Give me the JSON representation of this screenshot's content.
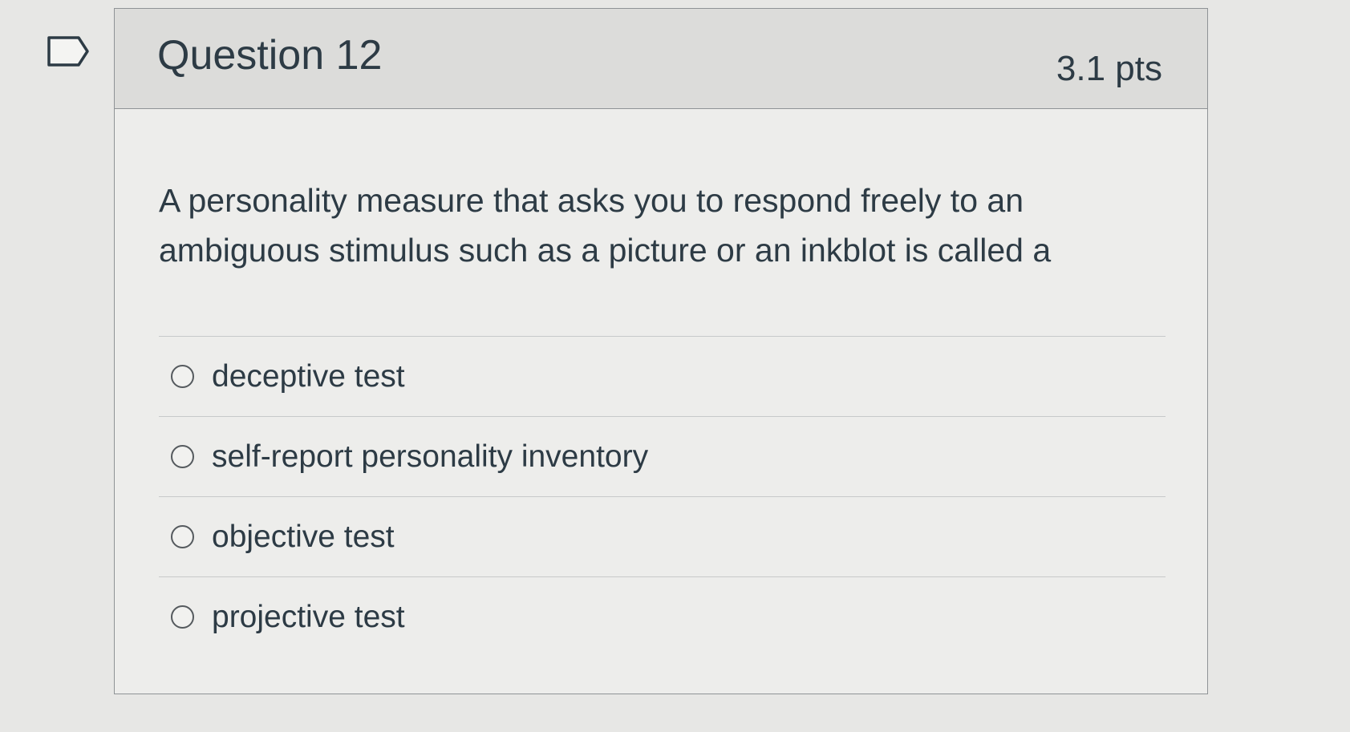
{
  "question": {
    "title": "Question 12",
    "points": "3.1 pts",
    "text": "A personality measure that asks you to respond freely to an ambiguous stimulus such as a picture or an inkblot is called a",
    "flag_icon": "flag-outline-icon",
    "answers": [
      {
        "label": "deceptive test",
        "selected": false
      },
      {
        "label": "self-report personality inventory",
        "selected": false
      },
      {
        "label": "objective test",
        "selected": false
      },
      {
        "label": "projective test",
        "selected": false
      }
    ]
  },
  "colors": {
    "background": "#e7e7e5",
    "header": "#dcdcda",
    "card": "#ededeb",
    "text": "#2d3b45",
    "border": "#8f9396"
  }
}
